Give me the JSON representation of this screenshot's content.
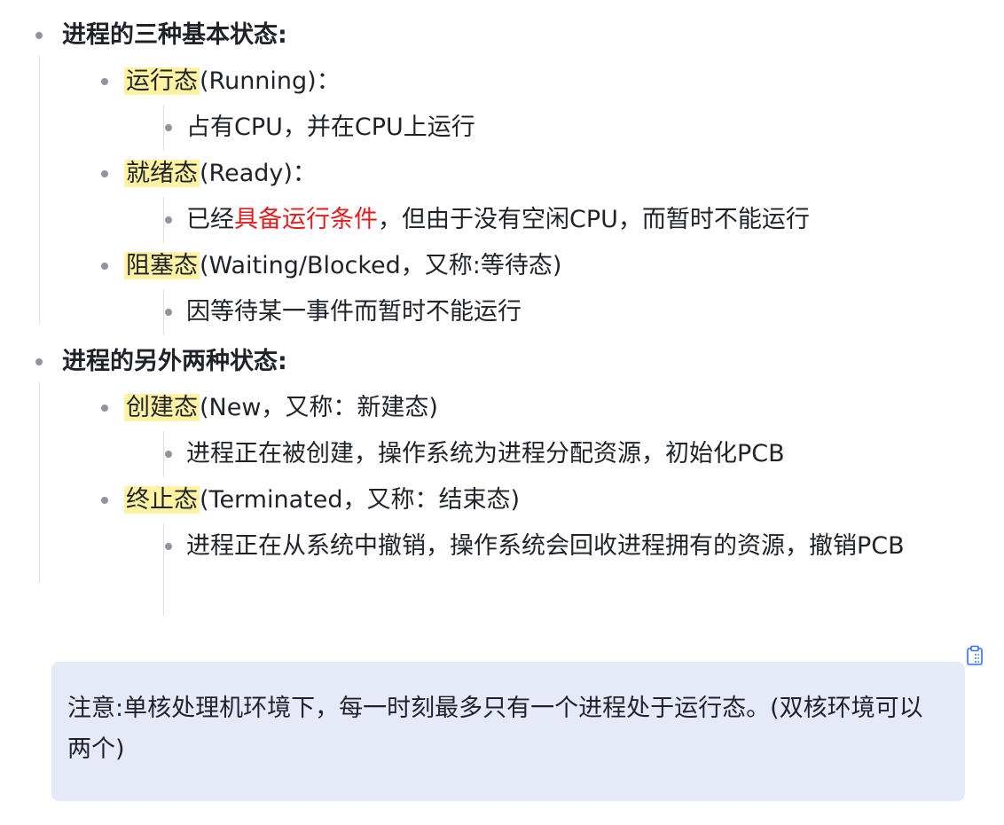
{
  "sections": [
    {
      "title": "进程的三种基本状态:",
      "items": [
        {
          "term": "运行态",
          "rest": "(Running)：",
          "details": [
            {
              "parts": [
                {
                  "text": "占有CPU，并在CPU上运行",
                  "style": "normal"
                }
              ]
            }
          ]
        },
        {
          "term": "就绪态",
          "rest": "(Ready)：",
          "details": [
            {
              "parts": [
                {
                  "text": "已经",
                  "style": "normal"
                },
                {
                  "text": "具备运行条件",
                  "style": "red"
                },
                {
                  "text": "，但由于没有空闲CPU，而暂时不能运行",
                  "style": "normal"
                }
              ]
            }
          ]
        },
        {
          "term": "阻塞态",
          "rest": "(Waiting/Blocked，又称:等待态)",
          "details": [
            {
              "parts": [
                {
                  "text": "因等待某一事件而暂时不能运行",
                  "style": "normal"
                }
              ]
            }
          ]
        }
      ]
    },
    {
      "title": "进程的另外两种状态:",
      "items": [
        {
          "term": "创建态",
          "rest": "(New，又称：新建态)",
          "details": [
            {
              "parts": [
                {
                  "text": "进程正在被创建，操作系统为进程分配资源，初始化PCB",
                  "style": "normal"
                }
              ]
            }
          ]
        },
        {
          "term": "终止态",
          "rest": "(Terminated，又称：结束态)",
          "details": [
            {
              "parts": [
                {
                  "text": "进程正在从系统中撤销，操作系统会回收进程拥有的资源，撤销PCB",
                  "style": "normal"
                }
              ]
            }
          ]
        }
      ]
    }
  ],
  "callout": {
    "text": "注意:单核处理机环境下，每一时刻最多只有一个进程处于运行态。(双核环境可以两个)"
  },
  "icons": {
    "copy": "clipboard-icon"
  },
  "colors": {
    "highlight": "#fff3a3",
    "emphasis_red": "#e01e1e",
    "callout_bg": "#e6e9f8",
    "bullet": "#8f959e"
  }
}
